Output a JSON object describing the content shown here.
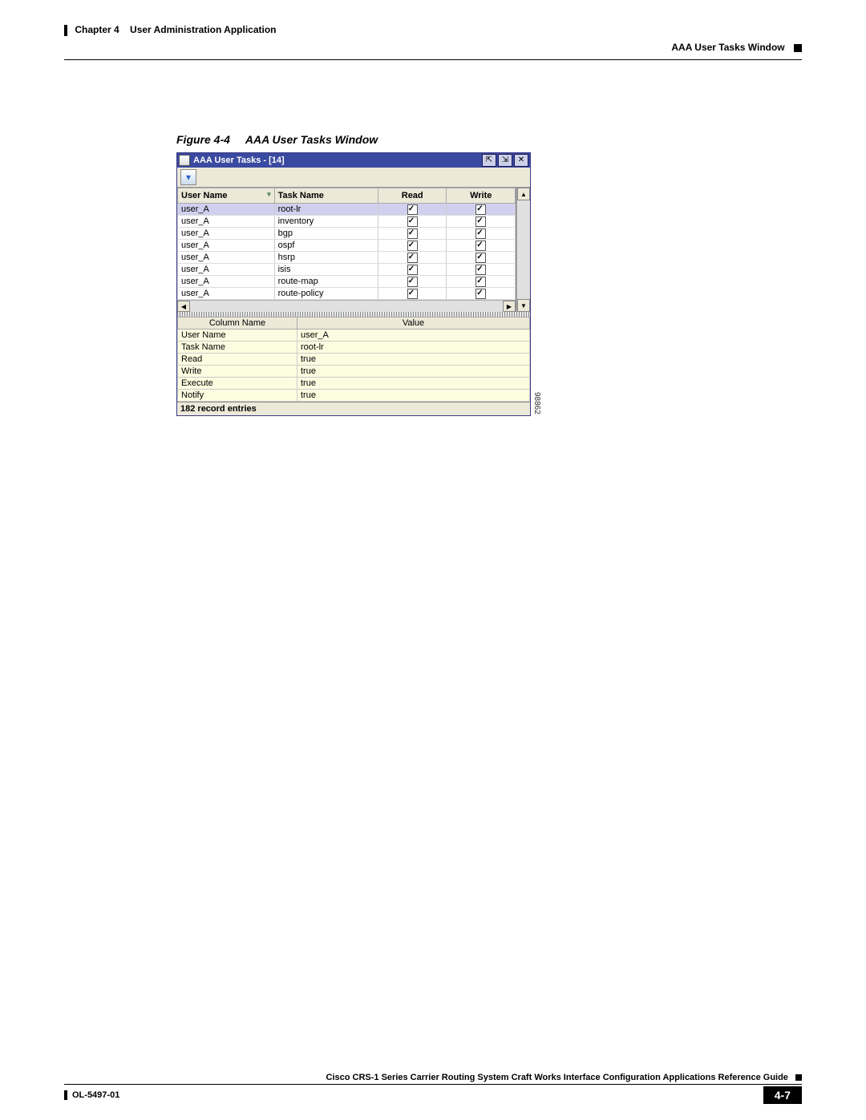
{
  "header": {
    "chapter": "Chapter 4",
    "app": "User Administration Application",
    "section": "AAA User Tasks Window"
  },
  "figure": {
    "label": "Figure 4-4",
    "title": "AAA User Tasks Window",
    "side_code": "98862"
  },
  "window": {
    "title": "AAA User Tasks - [14]",
    "columns": {
      "user": "User Name",
      "task": "Task Name",
      "read": "Read",
      "write": "Write"
    },
    "rows": [
      {
        "user": "user_A",
        "task": "root-lr",
        "read": true,
        "write": true,
        "sel": true
      },
      {
        "user": "user_A",
        "task": "inventory",
        "read": true,
        "write": true
      },
      {
        "user": "user_A",
        "task": "bgp",
        "read": true,
        "write": true
      },
      {
        "user": "user_A",
        "task": "ospf",
        "read": true,
        "write": true
      },
      {
        "user": "user_A",
        "task": "hsrp",
        "read": true,
        "write": true
      },
      {
        "user": "user_A",
        "task": "isis",
        "read": true,
        "write": true
      },
      {
        "user": "user_A",
        "task": "route-map",
        "read": true,
        "write": true
      },
      {
        "user": "user_A",
        "task": "route-policy",
        "read": true,
        "write": true
      }
    ],
    "detail_headers": {
      "name": "Column Name",
      "value": "Value"
    },
    "detail": [
      {
        "name": "User Name",
        "value": "user_A"
      },
      {
        "name": "Task Name",
        "value": "root-lr"
      },
      {
        "name": "Read",
        "value": "true"
      },
      {
        "name": "Write",
        "value": "true"
      },
      {
        "name": "Execute",
        "value": "true"
      },
      {
        "name": "Notify",
        "value": "true"
      }
    ],
    "status": "182 record entries"
  },
  "footer": {
    "guide": "Cisco CRS-1 Series Carrier Routing System Craft Works Interface Configuration Applications Reference Guide",
    "doc_id": "OL-5497-01",
    "page": "4-7"
  }
}
